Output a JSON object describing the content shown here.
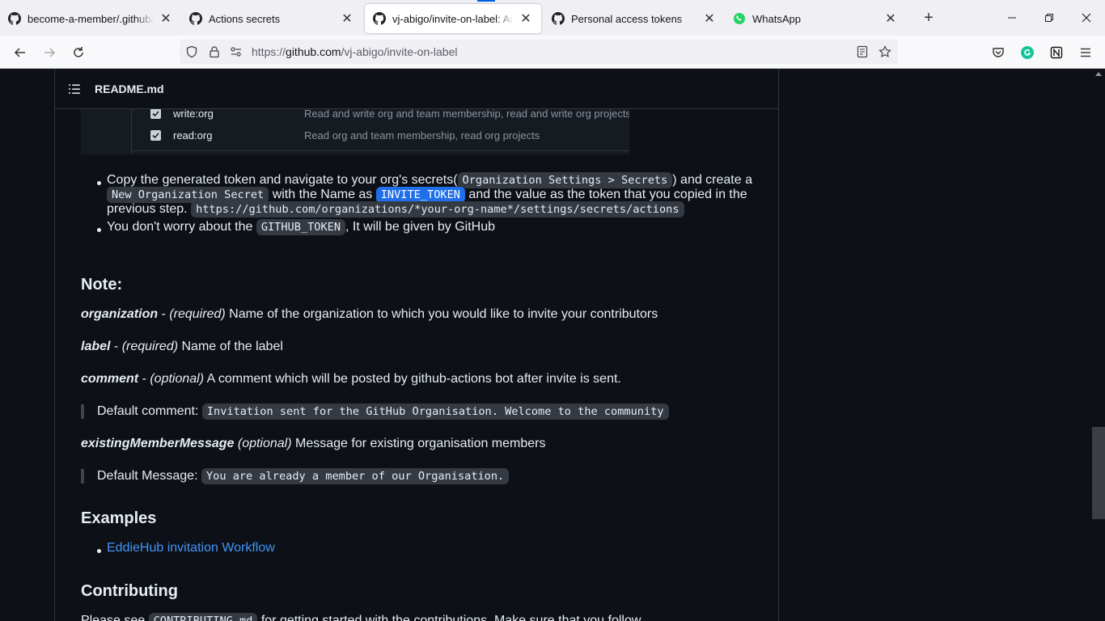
{
  "browser": {
    "tabs": [
      {
        "title": "become-a-member/.github/wo",
        "icon": "github-icon",
        "active": false
      },
      {
        "title": "Actions secrets",
        "icon": "github-icon",
        "active": false
      },
      {
        "title": "vj-abigo/invite-on-label: Autom",
        "icon": "github-icon",
        "active": true
      },
      {
        "title": "Personal access tokens",
        "icon": "github-icon",
        "active": false
      },
      {
        "title": "WhatsApp",
        "icon": "whatsapp-icon",
        "active": false
      }
    ],
    "url_prefix": "https://",
    "url_host": "github.com",
    "url_path": "/vj-abigo/invite-on-label"
  },
  "readme": {
    "title": "README.md",
    "scopes": [
      {
        "name": "write:org",
        "desc": "Read and write org and team membership, read and write org projects"
      },
      {
        "name": "read:org",
        "desc": "Read org and team membership, read org projects"
      }
    ],
    "bullet1": {
      "t1": "Copy the generated token and navigate to your org's secrets(",
      "c1": "Organization Settings > Secrets",
      "t2": ") and create a",
      "c2": "New Organization Secret",
      "t3": " with the Name as ",
      "c3": "INVITE_TOKEN",
      "t4": " and the value as the token that you copied in the",
      "t5": "previous step. ",
      "c4": "https://github.com/organizations/*your-org-name*/settings/secrets/actions"
    },
    "bullet2": {
      "t1": "You don't worry about the ",
      "c1": "GITHUB_TOKEN",
      "t2": ", It will be given by GitHub"
    },
    "note_heading": "Note:",
    "params": [
      {
        "name": "organization",
        "sep": " - ",
        "req": "(required)",
        "desc": " Name of the organization to which you would like to invite your contributors"
      },
      {
        "name": "label",
        "sep": " - ",
        "req": "(required)",
        "desc": " Name of the label"
      },
      {
        "name": "comment",
        "sep": " - ",
        "req": "(optional)",
        "desc": " A comment which will be posted by github-actions bot after invite is sent."
      },
      {
        "name": "existingMemberMessage",
        "sep": " ",
        "req": "(optional)",
        "desc": " Message for existing organisation members"
      }
    ],
    "default_comment_label": "Default comment: ",
    "default_comment_value": "Invitation sent for the GitHub Organisation. Welcome to the community",
    "default_message_label": "Default Message: ",
    "default_message_value": "You are already a member of our Organisation.",
    "examples_heading": "Examples",
    "example_link": "EddieHub invitation Workflow",
    "contributing_heading": "Contributing",
    "contributing_t1": "Please see ",
    "contributing_c1": "CONTRIBUTING.md",
    "contributing_t2": " for getting started with the contributions. Make sure that you follow"
  }
}
